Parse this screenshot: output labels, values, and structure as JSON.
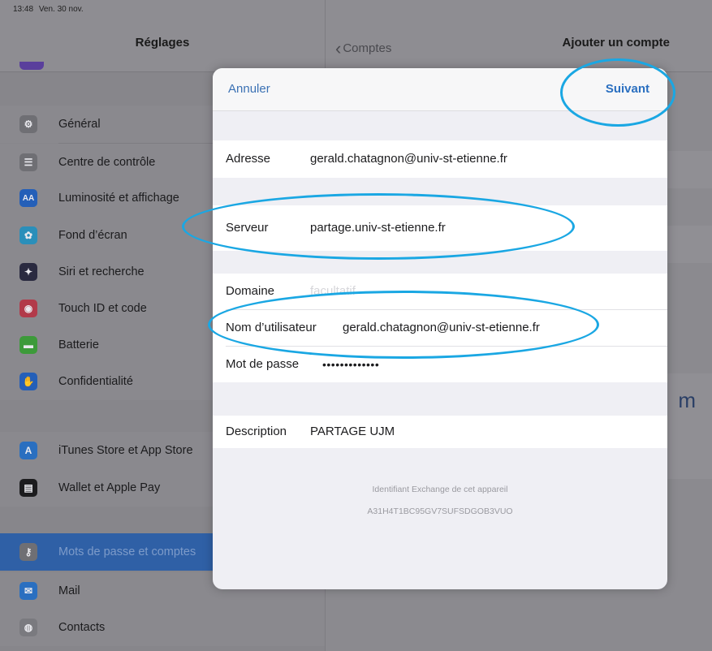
{
  "status_bar": {
    "time": "13:48",
    "date": "Ven. 30 nov."
  },
  "settings": {
    "title": "Réglages",
    "items": [
      {
        "label": "Général",
        "icon": "gear-icon",
        "color": "#6f6f74"
      },
      {
        "label": "Centre de contrôle",
        "icon": "toggles-icon",
        "color": "#6f6f74"
      },
      {
        "label": "Luminosité et affichage",
        "icon": "brightness-icon",
        "color": "#245fb8"
      },
      {
        "label": "Fond d’écran",
        "icon": "wallpaper-icon",
        "color": "#2a8fba"
      },
      {
        "label": "Siri et recherche",
        "icon": "siri-icon",
        "color": "#2a2a40"
      },
      {
        "label": "Touch ID et code",
        "icon": "fingerprint-icon",
        "color": "#b23a4a"
      },
      {
        "label": "Batterie",
        "icon": "battery-icon",
        "color": "#3d9a3a"
      },
      {
        "label": "Confidentialité",
        "icon": "hand-icon",
        "color": "#245fb8"
      },
      {
        "label": "iTunes Store et App Store",
        "icon": "appstore-icon",
        "color": "#2a6fc0"
      },
      {
        "label": "Wallet et Apple Pay",
        "icon": "wallet-icon",
        "color": "#1c1c1e"
      },
      {
        "label": "Mots de passe et comptes",
        "icon": "key-icon",
        "color": "#6f6f74"
      },
      {
        "label": "Mail",
        "icon": "mail-icon",
        "color": "#2a6fc0"
      },
      {
        "label": "Contacts",
        "icon": "contacts-icon",
        "color": "#7a7a7f"
      }
    ]
  },
  "accounts": {
    "back_label": "Comptes",
    "title": "Ajouter un compte",
    "partial_text": "m"
  },
  "modal": {
    "cancel_label": "Annuler",
    "next_label": "Suivant",
    "fields": {
      "address": {
        "label": "Adresse",
        "value": "gerald.chatagnon@univ-st-etienne.fr"
      },
      "server": {
        "label": "Serveur",
        "value": "partage.univ-st-etienne.fr"
      },
      "domain": {
        "label": "Domaine",
        "placeholder": "facultatif"
      },
      "username": {
        "label": "Nom d’utilisateur",
        "value": "gerald.chatagnon@univ-st-etienne.fr"
      },
      "password": {
        "label": "Mot de passe",
        "value": "•••••••••••••"
      },
      "description": {
        "label": "Description",
        "value": "PARTAGE UJM"
      }
    },
    "device_id_label": "Identifiant Exchange de cet appareil",
    "device_id": "A31H4T1BC95GV7SUFSDGOB3VUO"
  },
  "colors": {
    "accent": "#2a6fc0",
    "highlight": "#1aa7e3"
  }
}
